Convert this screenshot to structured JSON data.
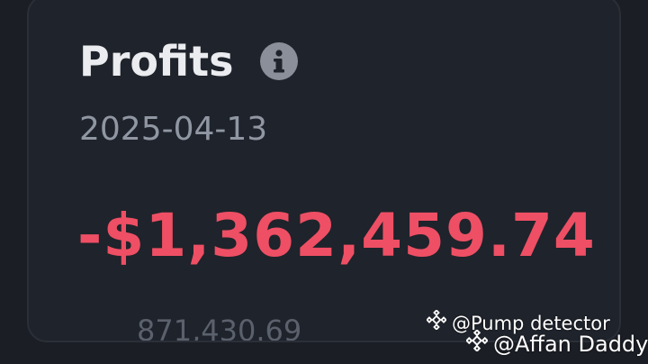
{
  "card": {
    "title": "Profits",
    "info_icon": "info-icon",
    "date": "2025-04-13",
    "amount": "-$1,362,459.74",
    "amount_color": "#ee4f64",
    "sub_amount": "871,430.69"
  },
  "watermarks": [
    {
      "text": "@Pump detector",
      "logo": "binance-logo-icon"
    },
    {
      "text": "@Affan Daddy",
      "logo": "binance-logo-icon"
    }
  ]
}
